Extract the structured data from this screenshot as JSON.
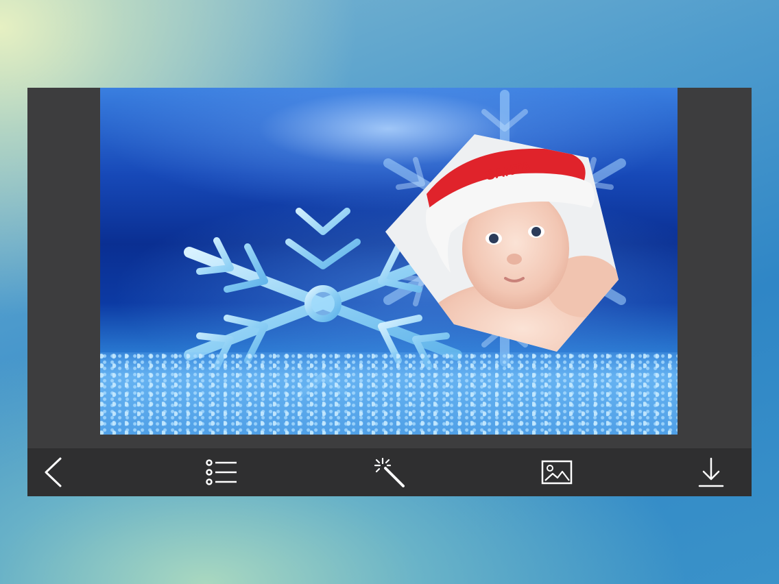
{
  "editor": {
    "photo_caption": "SANTA"
  },
  "toolbar": {
    "back": "chevron-left-icon",
    "frames": "list-icon",
    "effects": "magic-wand-icon",
    "gallery": "image-icon",
    "save": "download-icon"
  },
  "colors": {
    "app_bg": "#3d3d3e",
    "toolbar_bg": "#2f2f30",
    "icon": "#ffffff",
    "hat_red": "#e0232b"
  }
}
